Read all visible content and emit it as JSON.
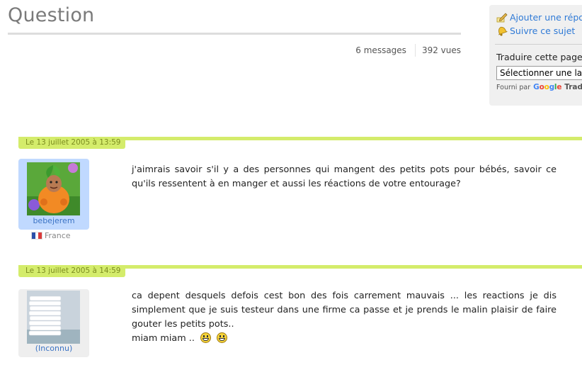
{
  "page": {
    "title": "Question",
    "messages_count": "6 messages",
    "views_count": "392 vues"
  },
  "sidebar": {
    "add_reply": "Ajouter une réponse",
    "follow": "Suivre ce sujet",
    "translate_label": "Traduire cette page",
    "translate_select": "Sélectionner une langue",
    "powered_by": "Fourni par",
    "google": "Google",
    "translate_word": "Traduction"
  },
  "posts": [
    {
      "date": "Le 13 juillet 2005 à 13:59",
      "username": "bebejerem",
      "country": "France",
      "text": "j'aimrais savoir s'il y a des personnes qui mangent des petits pots pour bébés, savoir ce qu'ils ressentent à en manger et aussi les réactions de votre entourage?"
    },
    {
      "date": "Le 13 juillet 2005 à 14:59",
      "username": "(Inconnu)",
      "text": "ca depent desquels defois cest bon des fois carrement mauvais ... les reactions je dis simplement que je suis testeur dans une firme ca passe et je prends le malin plaisir de faire gouter les petits pots..",
      "text2": "miam miam .."
    }
  ],
  "colors": {
    "accent_bar": "#d4ec6b",
    "date_text": "#7c8d20",
    "link": "#2f7ad6",
    "avatar_bg_1": "#c0d9ff",
    "avatar_bg_2": "#eeeeee"
  }
}
